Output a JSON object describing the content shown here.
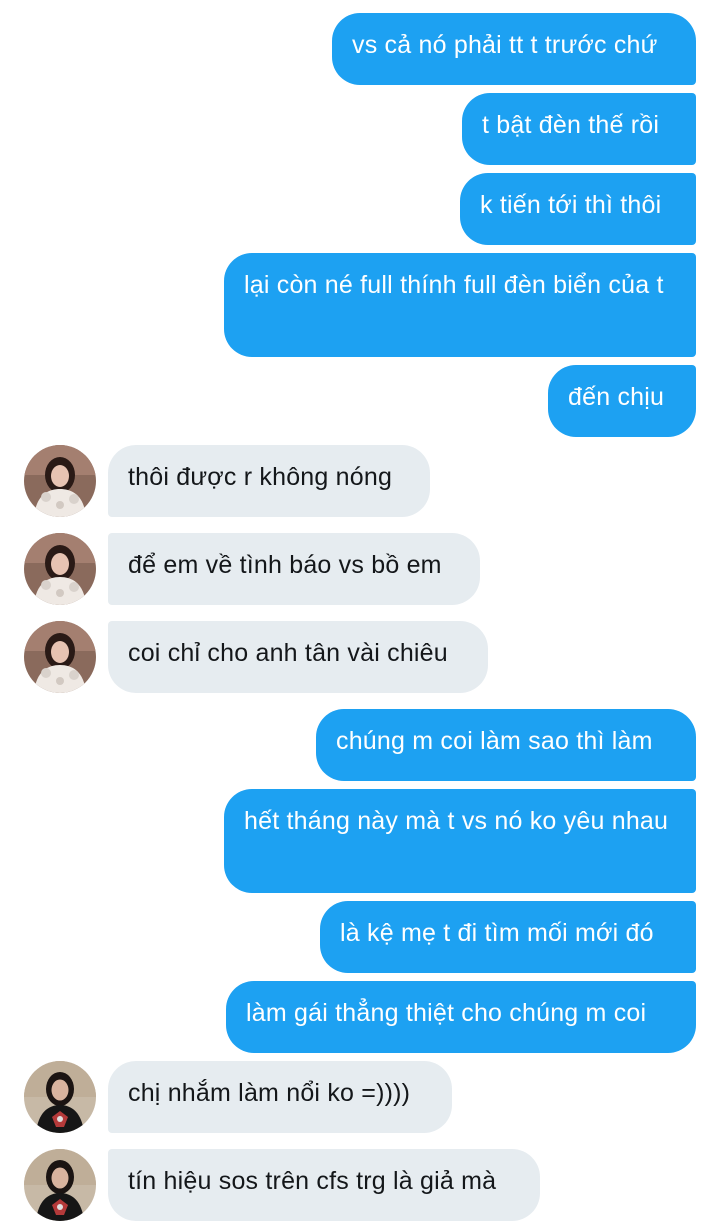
{
  "messages": [
    {
      "side": "out",
      "text": "vs cả nó phải tt t trước chứ"
    },
    {
      "side": "out",
      "text": "t bật đèn thế rồi"
    },
    {
      "side": "out",
      "text": "k tiến tới thì thôi"
    },
    {
      "side": "out",
      "text": "lại còn né full thính full đèn biển của t"
    },
    {
      "side": "out",
      "text": "đến chịu"
    },
    {
      "side": "in",
      "avatar": "avatar-girl-white-coat",
      "text": "thôi được r không nóng"
    },
    {
      "side": "in",
      "avatar": "avatar-girl-white-coat",
      "text": "để em về tình báo vs bồ em"
    },
    {
      "side": "in",
      "avatar": "avatar-girl-white-coat",
      "text": "coi chỉ cho anh tân vài chiêu"
    },
    {
      "side": "out",
      "text": "chúng m coi làm sao thì làm"
    },
    {
      "side": "out",
      "text": "hết tháng này mà t vs nó ko yêu nhau"
    },
    {
      "side": "out",
      "text": "là kệ mẹ t đi tìm mối mới đó"
    },
    {
      "side": "out",
      "text": "làm gái thẳng thiệt cho chúng m coi"
    },
    {
      "side": "in",
      "avatar": "avatar-girl-black-shirt",
      "text": "chị nhắm làm nổi ko =))))"
    },
    {
      "side": "in",
      "avatar": "avatar-girl-black-shirt",
      "text": "tín hiệu sos trên cfs trg là giả mà"
    }
  ],
  "colors": {
    "outgoing_bubble": "#1da1f2",
    "incoming_bubble": "#e6ecf0",
    "outgoing_text": "#ffffff",
    "incoming_text": "#14171a"
  }
}
